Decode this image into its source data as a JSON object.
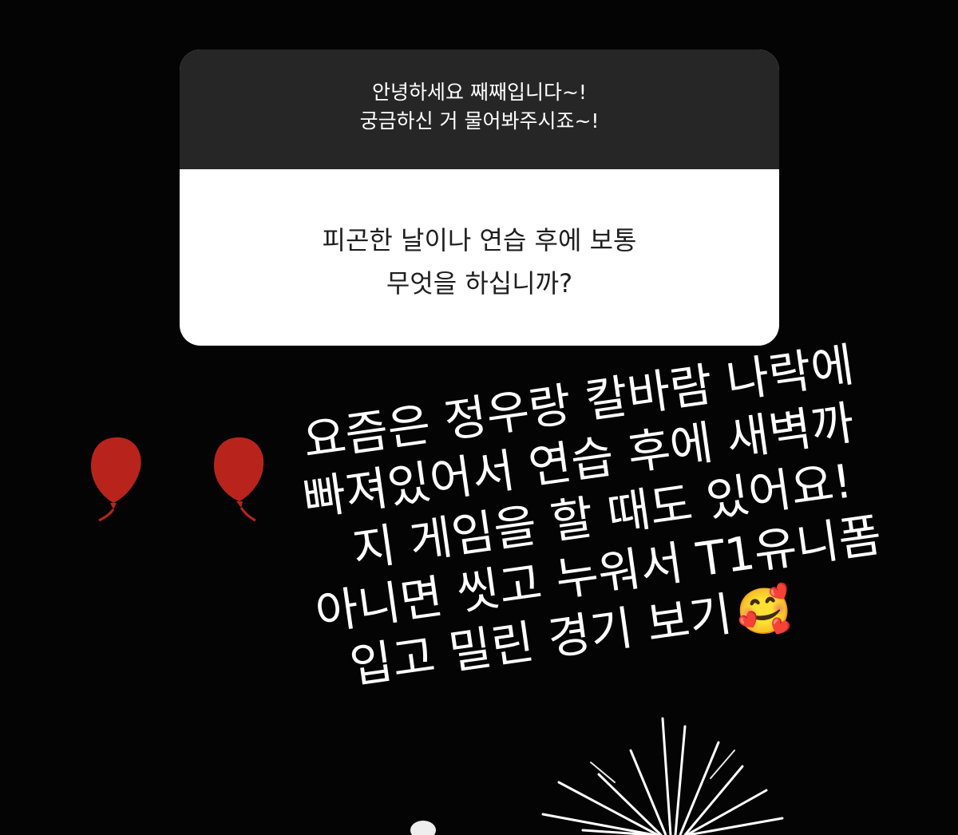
{
  "story": {
    "prompt": {
      "line1": "안녕하세요 째째입니다~!",
      "line2": "궁금하신 거 물어봐주시죠~!"
    },
    "question": {
      "line1": "피곤한 날이나 연습 후에 보통",
      "line2": "무엇을 하십니까?"
    },
    "reply": {
      "line1": "요즘은 정우랑 칼바람 나락에",
      "line2": "빠져있어서 연습 후에 새벽까",
      "line3": "지 게임을 할 때도 있어요!",
      "line4": "아니면 씻고 누워서 T1유니폼",
      "line5": "입고 밀린 경기 보기",
      "emoji": "🥰"
    },
    "stickers": {
      "balloon_left": "balloon-icon",
      "balloon_right": "balloon-icon",
      "firework": "firework-icon"
    },
    "colors": {
      "background": "#040404",
      "prompt_bg": "#262626",
      "card_bg": "#ffffff",
      "balloon": "#b8241c"
    }
  }
}
